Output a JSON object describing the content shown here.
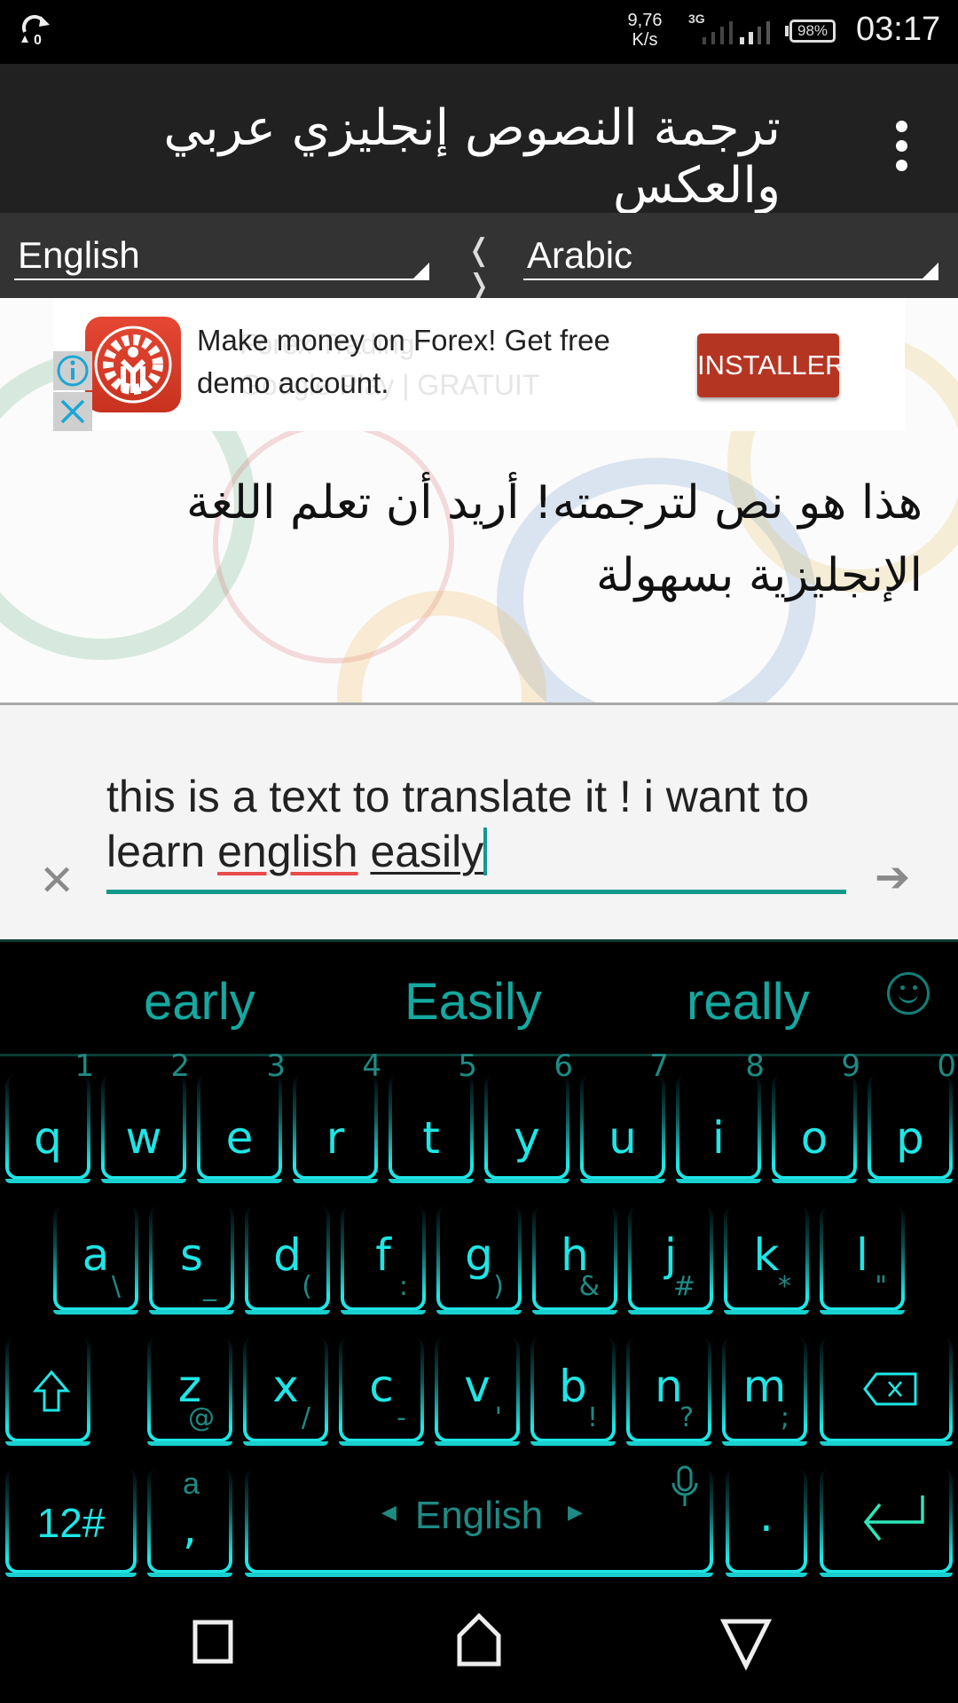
{
  "status_bar": {
    "left_icon": "sync-icon",
    "net_speed_value": "9,76",
    "net_speed_unit": "K/s",
    "network_type": "3G",
    "battery": "98%",
    "time": "03:17"
  },
  "app_bar": {
    "title": "ترجمة النصوص إنجليزي عربي والعكس",
    "menu_icon": "more-vert-icon"
  },
  "languages": {
    "source": "English",
    "swap_icon": "swap-arrows-icon",
    "swap_label": "❬ ❭",
    "target": "Arabic"
  },
  "ad": {
    "ghost_title": "Forex Trading",
    "ghost_subtitle": "Google Play | GRATUIT",
    "headline": "Make money on Forex! Get free demo account.",
    "cta": "INSTALLER",
    "info_icon": "info-icon",
    "close_icon": "close-icon",
    "colors": {
      "cta": "#b53523",
      "icon": "#d93d2a"
    }
  },
  "translation": {
    "output": "هذا هو نص لترجمته! أريد أن تعلم اللغة الإنجليزية بسهولة"
  },
  "input": {
    "text_before": " this is a text to translate it ! i want to learn ",
    "misspelled_word": "english",
    "composing_word": "easily",
    "clear_icon": "clear-icon",
    "clear_label": "✕",
    "submit_icon": "arrow-right-icon",
    "submit_label": "➔",
    "accent_color": "#11998c"
  },
  "keyboard": {
    "suggestions": [
      "early",
      "Easily",
      "really"
    ],
    "emoji_icon": "smiley-icon",
    "row1": [
      {
        "key": "q",
        "num": "1"
      },
      {
        "key": "w",
        "num": "2"
      },
      {
        "key": "e",
        "num": "3"
      },
      {
        "key": "r",
        "num": "4"
      },
      {
        "key": "t",
        "num": "5"
      },
      {
        "key": "y",
        "num": "6"
      },
      {
        "key": "u",
        "num": "7"
      },
      {
        "key": "i",
        "num": "8"
      },
      {
        "key": "o",
        "num": "9"
      },
      {
        "key": "p",
        "num": "0"
      }
    ],
    "row2": [
      {
        "key": "a",
        "sub": "\\"
      },
      {
        "key": "s",
        "sub": "_"
      },
      {
        "key": "d",
        "sub": "("
      },
      {
        "key": "f",
        "sub": ":"
      },
      {
        "key": "g",
        "sub": ")"
      },
      {
        "key": "h",
        "sub": "&"
      },
      {
        "key": "j",
        "sub": "#"
      },
      {
        "key": "k",
        "sub": "*"
      },
      {
        "key": "l",
        "sub": "\""
      }
    ],
    "row3": [
      {
        "key": "z",
        "sub": "@"
      },
      {
        "key": "x",
        "sub": "/"
      },
      {
        "key": "c",
        "sub": "-"
      },
      {
        "key": "v",
        "sub": "'"
      },
      {
        "key": "b",
        "sub": "!"
      },
      {
        "key": "n",
        "sub": "?"
      },
      {
        "key": "m",
        "sub": ";"
      }
    ],
    "shift_icon": "shift-icon",
    "backspace_icon": "backspace-icon",
    "symbols_label": "12#",
    "comma_label": ",",
    "comma_alt": "a",
    "space_label": "English",
    "mic_icon": "mic-icon",
    "period_label": ".",
    "enter_icon": "enter-icon",
    "key_color": "#1ee6e6"
  },
  "nav_bar": {
    "recents_icon": "recents-icon",
    "home_icon": "home-icon",
    "back_icon": "back-icon"
  }
}
